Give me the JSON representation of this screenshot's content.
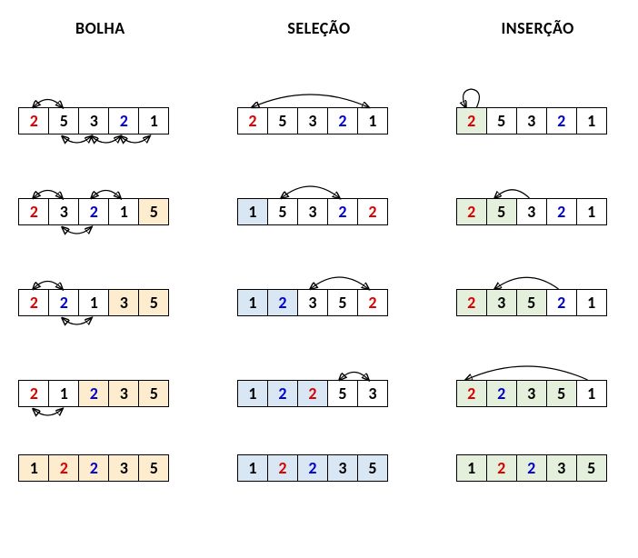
{
  "title_bolha": "BOLHA",
  "title_selecao": "SELEÇÃO",
  "title_insercao": "INSERÇÃO",
  "chart_data": {
    "type": "table",
    "description": "Comparison of Bubble, Selection and Insertion sort on array [2,5,3,2,1]. Colors: red/blue mark duplicate 2s, shaded cells mark sorted region.",
    "input": [
      2,
      5,
      3,
      2,
      1
    ],
    "algorithms": [
      {
        "name": "BOLHA",
        "steps": [
          {
            "cells": [
              {
                "v": "2",
                "c": "red"
              },
              {
                "v": "5",
                "c": "black"
              },
              {
                "v": "3",
                "c": "black"
              },
              {
                "v": "2",
                "c": "blue"
              },
              {
                "v": "1",
                "c": "black"
              }
            ],
            "swaps_top": [
              [
                0,
                1
              ]
            ],
            "swaps_bot": [
              [
                1,
                2
              ],
              [
                2,
                3
              ],
              [
                3,
                4
              ]
            ]
          },
          {
            "cells": [
              {
                "v": "2",
                "c": "red"
              },
              {
                "v": "3",
                "c": "black"
              },
              {
                "v": "2",
                "c": "blue"
              },
              {
                "v": "1",
                "c": "black"
              },
              {
                "v": "5",
                "c": "black",
                "bg": "y"
              }
            ],
            "swaps_top": [
              [
                0,
                1
              ],
              [
                2,
                3
              ]
            ],
            "swaps_bot": [
              [
                1,
                2
              ]
            ]
          },
          {
            "cells": [
              {
                "v": "2",
                "c": "red"
              },
              {
                "v": "2",
                "c": "blue"
              },
              {
                "v": "1",
                "c": "black"
              },
              {
                "v": "3",
                "c": "black",
                "bg": "y"
              },
              {
                "v": "5",
                "c": "black",
                "bg": "y"
              }
            ],
            "swaps_top": [
              [
                0,
                1
              ]
            ],
            "swaps_bot": [
              [
                1,
                2
              ]
            ]
          },
          {
            "cells": [
              {
                "v": "2",
                "c": "red"
              },
              {
                "v": "1",
                "c": "black"
              },
              {
                "v": "2",
                "c": "blue",
                "bg": "y"
              },
              {
                "v": "3",
                "c": "black",
                "bg": "y"
              },
              {
                "v": "5",
                "c": "black",
                "bg": "y"
              }
            ],
            "swaps_bot": [
              [
                0,
                1
              ]
            ]
          },
          {
            "cells": [
              {
                "v": "1",
                "c": "black",
                "bg": "y"
              },
              {
                "v": "2",
                "c": "red",
                "bg": "y"
              },
              {
                "v": "2",
                "c": "blue",
                "bg": "y"
              },
              {
                "v": "3",
                "c": "black",
                "bg": "y"
              },
              {
                "v": "5",
                "c": "black",
                "bg": "y"
              }
            ]
          }
        ]
      },
      {
        "name": "SELEÇÃO",
        "steps": [
          {
            "cells": [
              {
                "v": "2",
                "c": "red"
              },
              {
                "v": "5",
                "c": "black"
              },
              {
                "v": "3",
                "c": "black"
              },
              {
                "v": "2",
                "c": "blue"
              },
              {
                "v": "1",
                "c": "black"
              }
            ],
            "swap": [
              0,
              4
            ]
          },
          {
            "cells": [
              {
                "v": "1",
                "c": "black",
                "bg": "b"
              },
              {
                "v": "5",
                "c": "black"
              },
              {
                "v": "3",
                "c": "black"
              },
              {
                "v": "2",
                "c": "blue"
              },
              {
                "v": "2",
                "c": "red"
              }
            ],
            "swap": [
              1,
              3
            ]
          },
          {
            "cells": [
              {
                "v": "1",
                "c": "black",
                "bg": "b"
              },
              {
                "v": "2",
                "c": "blue",
                "bg": "b"
              },
              {
                "v": "3",
                "c": "black"
              },
              {
                "v": "5",
                "c": "black"
              },
              {
                "v": "2",
                "c": "red"
              }
            ],
            "swap": [
              2,
              4
            ]
          },
          {
            "cells": [
              {
                "v": "1",
                "c": "black",
                "bg": "b"
              },
              {
                "v": "2",
                "c": "blue",
                "bg": "b"
              },
              {
                "v": "2",
                "c": "red",
                "bg": "b"
              },
              {
                "v": "5",
                "c": "black"
              },
              {
                "v": "3",
                "c": "black"
              }
            ],
            "swap": [
              3,
              4
            ]
          },
          {
            "cells": [
              {
                "v": "1",
                "c": "black",
                "bg": "b"
              },
              {
                "v": "2",
                "c": "red",
                "bg": "b"
              },
              {
                "v": "2",
                "c": "blue",
                "bg": "b"
              },
              {
                "v": "3",
                "c": "black",
                "bg": "b"
              },
              {
                "v": "5",
                "c": "black",
                "bg": "b"
              }
            ]
          }
        ]
      },
      {
        "name": "INSERÇÃO",
        "steps": [
          {
            "cells": [
              {
                "v": "2",
                "c": "red",
                "bg": "g"
              },
              {
                "v": "5",
                "c": "black"
              },
              {
                "v": "3",
                "c": "black"
              },
              {
                "v": "2",
                "c": "blue"
              },
              {
                "v": "1",
                "c": "black"
              }
            ],
            "ins": [
              0,
              0
            ]
          },
          {
            "cells": [
              {
                "v": "2",
                "c": "red",
                "bg": "g"
              },
              {
                "v": "5",
                "c": "black",
                "bg": "g"
              },
              {
                "v": "3",
                "c": "black"
              },
              {
                "v": "2",
                "c": "blue"
              },
              {
                "v": "1",
                "c": "black"
              }
            ],
            "ins": [
              2,
              1
            ]
          },
          {
            "cells": [
              {
                "v": "2",
                "c": "red",
                "bg": "g"
              },
              {
                "v": "3",
                "c": "black",
                "bg": "g"
              },
              {
                "v": "5",
                "c": "black",
                "bg": "g"
              },
              {
                "v": "2",
                "c": "blue"
              },
              {
                "v": "1",
                "c": "black"
              }
            ],
            "ins": [
              3,
              1
            ]
          },
          {
            "cells": [
              {
                "v": "2",
                "c": "red",
                "bg": "g"
              },
              {
                "v": "2",
                "c": "blue",
                "bg": "g"
              },
              {
                "v": "3",
                "c": "black",
                "bg": "g"
              },
              {
                "v": "5",
                "c": "black",
                "bg": "g"
              },
              {
                "v": "1",
                "c": "black"
              }
            ],
            "ins": [
              4,
              0
            ]
          },
          {
            "cells": [
              {
                "v": "1",
                "c": "black",
                "bg": "g"
              },
              {
                "v": "2",
                "c": "red",
                "bg": "g"
              },
              {
                "v": "2",
                "c": "blue",
                "bg": "g"
              },
              {
                "v": "3",
                "c": "black",
                "bg": "g"
              },
              {
                "v": "5",
                "c": "black",
                "bg": "g"
              }
            ]
          }
        ]
      }
    ]
  }
}
